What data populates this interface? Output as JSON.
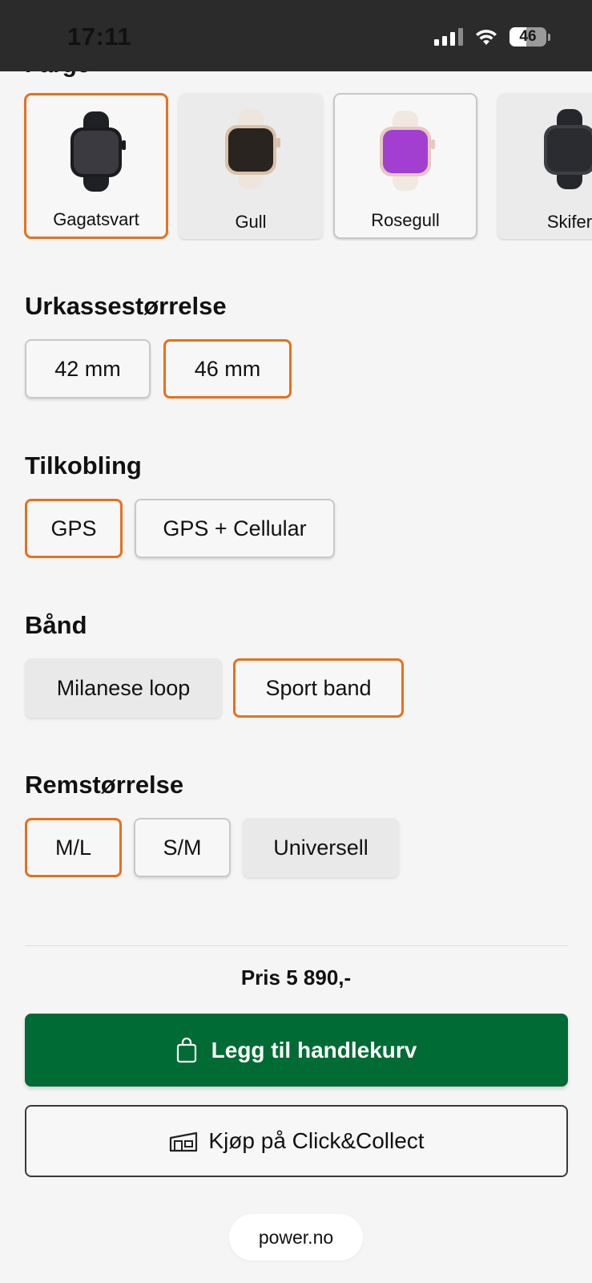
{
  "status_bar": {
    "time": "17:11",
    "battery": "46"
  },
  "color_section": {
    "title": "Farge"
  },
  "colors": [
    {
      "label": "Gagatsvart",
      "case": "#1c1c1e",
      "band": "#1f2024",
      "screen": "#3a3a40",
      "selected": true
    },
    {
      "label": "Gull",
      "case": "#d9c2a8",
      "band": "#eee6dd",
      "screen": "#2a2420",
      "selected": false
    },
    {
      "label": "Rosegull",
      "case": "#e6c8bd",
      "band": "#f1e8e2",
      "screen": "#a23fd0",
      "selected": false
    },
    {
      "label": "Skifer",
      "case": "#3d3f44",
      "band": "#25272c",
      "screen": "#2a2c30",
      "selected": false
    }
  ],
  "case_size": {
    "title": "Urkassestørrelse",
    "options": [
      "42 mm",
      "46 mm"
    ]
  },
  "connectivity": {
    "title": "Tilkobling",
    "options": [
      "GPS",
      "GPS + Cellular"
    ]
  },
  "band": {
    "title": "Bånd",
    "options": [
      "Milanese loop",
      "Sport band"
    ]
  },
  "strap_size": {
    "title": "Remstørrelse",
    "options": [
      "M/L",
      "S/M",
      "Universell"
    ]
  },
  "price": "Pris 5 890,-",
  "buttons": {
    "add_to_cart": "Legg til handlekurv",
    "click_collect": "Kjøp på Click&Collect"
  },
  "browser": {
    "url": "power.no"
  },
  "accent_colors": {
    "selected_border": "#e8701c",
    "primary_button": "#006b35"
  }
}
